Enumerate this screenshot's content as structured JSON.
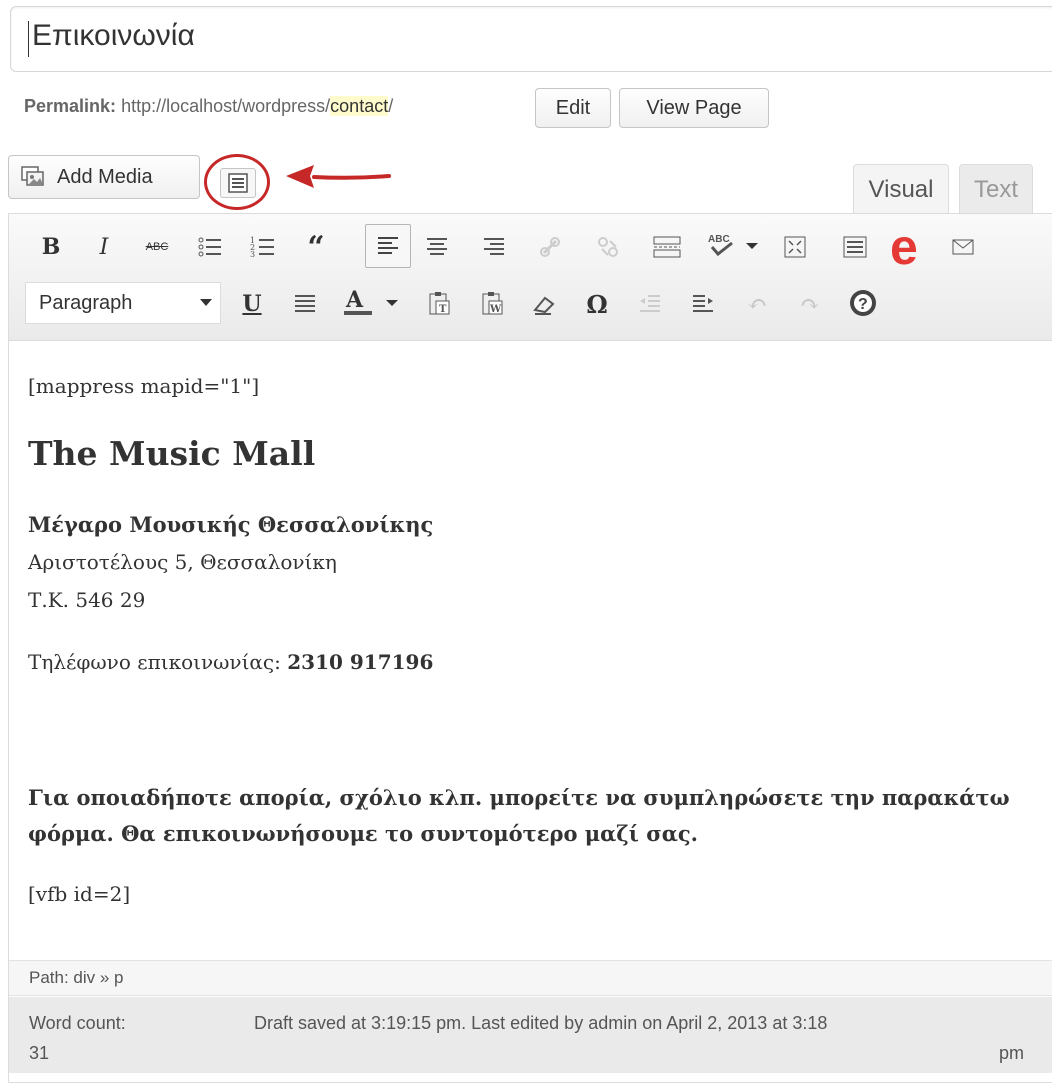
{
  "post": {
    "title": "Επικοινωνία",
    "permalink_label": "Permalink:",
    "permalink_base": "http://localhost/wordpress/",
    "permalink_slug": "contact",
    "permalink_tail": "/",
    "edit_label": "Edit",
    "view_label": "View Page"
  },
  "media": {
    "add_media_label": "Add Media"
  },
  "tabs": {
    "visual": "Visual",
    "text": "Text"
  },
  "toolbar": {
    "row1": [
      "bold",
      "italic",
      "strikethrough",
      "bullet-list",
      "numbered-list",
      "blockquote",
      "align-left",
      "align-center",
      "align-right",
      "insert-link",
      "unlink",
      "insert-more",
      "spellcheck",
      "fullscreen",
      "toolbar-toggle",
      "evernote",
      "email"
    ],
    "format_select": "Paragraph",
    "row2": [
      "underline",
      "justify",
      "text-color",
      "paste-text",
      "paste-word",
      "clear-formatting",
      "special-character",
      "outdent",
      "indent",
      "undo",
      "redo",
      "help"
    ]
  },
  "content": {
    "shortcode_map": "[mappress mapid=\"1\"]",
    "heading": "The Music Mall",
    "address_name": "Μέγαρο Μουσικής Θεσσαλονίκης",
    "address_street": "Αριστοτέλους 5, Θεσσαλονίκη",
    "address_zip": "Τ.Κ. 546 29",
    "phone_label": "Τηλέφωνο επικοινωνίας: ",
    "phone_number": "2310 917196",
    "note": "Για οποιαδήποτε απορία, σχόλιο κλπ. μπορείτε να συμπληρώσετε την παρακάτω φόρμα. Θα επικοινωνήσουμε το συντομότερο μαζί σας.",
    "shortcode_form": "[vfb id=2]"
  },
  "path": "Path: div » p",
  "status": {
    "word_count_label": "Word count:",
    "word_count": "31",
    "draft_saved": "Draft saved at 3:19:15 pm. Last edited by admin on April 2, 2013 at 3:18",
    "draft_saved_tail": "pm"
  },
  "colors": {
    "highlight": "#c62828",
    "evernote": "#e53935"
  }
}
